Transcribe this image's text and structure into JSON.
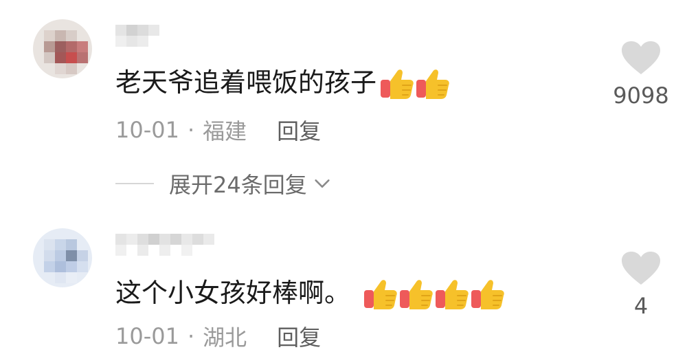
{
  "comments": [
    {
      "text": "老天爷追着喂饭的孩子",
      "emoji_count": 2,
      "date": "10-01",
      "separator": "·",
      "location": "福建",
      "reply_label": "回复",
      "expand_replies_label": "展开24条回复",
      "like_count": "9098",
      "icons": {
        "like": "heart-icon",
        "emoji": "thumbs-up-icon",
        "expand": "chevron-down-icon"
      }
    },
    {
      "text": "这个小女孩好棒啊。",
      "emoji_count": 4,
      "date": "10-01",
      "separator": "·",
      "location": "湖北",
      "reply_label": "回复",
      "like_count": "4",
      "icons": {
        "like": "heart-icon",
        "emoji": "thumbs-up-icon"
      }
    }
  ],
  "colors": {
    "meta_text": "#9a9a9a",
    "like_icon": "#d9d9d9",
    "thumb_yellow": "#f6c12a",
    "thumb_sleeve": "#ee5a5a"
  }
}
